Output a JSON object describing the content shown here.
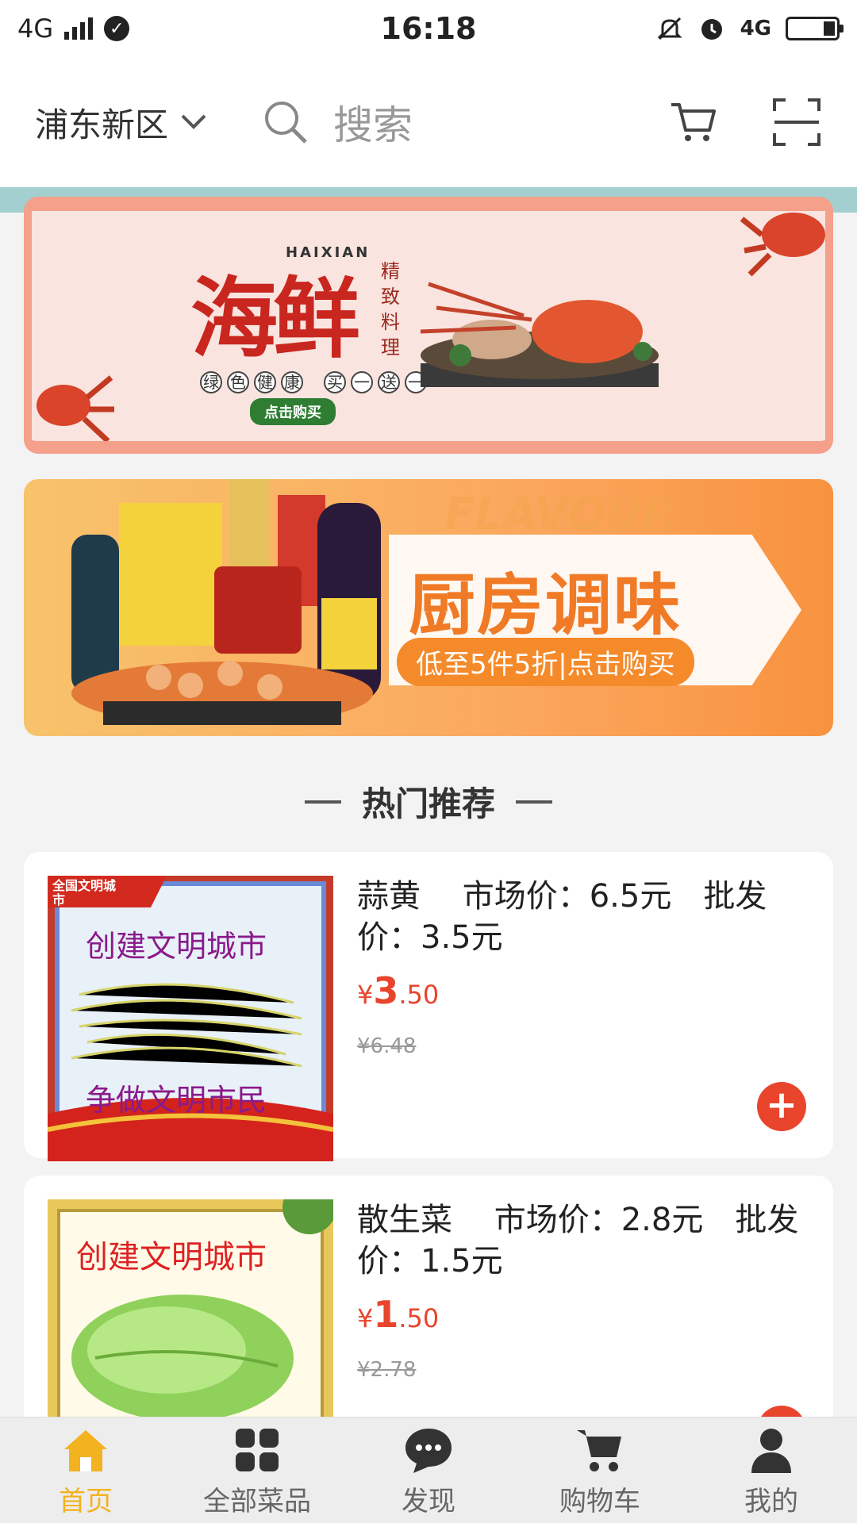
{
  "status_bar": {
    "network": "4G",
    "time": "16:18",
    "network_right": "4G"
  },
  "header": {
    "district": "浦东新区",
    "search_placeholder": "搜索"
  },
  "banners": {
    "seafood": {
      "title": "海鲜",
      "english": "HAIXIAN",
      "side_text": "精致料理",
      "tags": [
        "绿",
        "色",
        "健",
        "康",
        "买",
        "一",
        "送",
        "一"
      ],
      "button": "点击购买"
    },
    "kitchen": {
      "watermark": "FLAVOUR",
      "title": "厨房调味",
      "subtitle": "低至5件5折|点击购买"
    }
  },
  "section_title": "热门推荐",
  "products": [
    {
      "name": "蒜黄　 市场价：6.5元　批发价：3.5元",
      "currency": "¥",
      "price_int": "3",
      "price_dec": ".50",
      "old_price": "¥6.48",
      "image_banner_top": "创建文明城市",
      "image_banner_bottom": "争做文明市民",
      "image_corner": "全国文明城市"
    },
    {
      "name": "散生菜　 市场价：2.8元　批发价：1.5元",
      "currency": "¥",
      "price_int": "1",
      "price_dec": ".50",
      "old_price": "¥2.78",
      "image_banner_top": "创建文明城市"
    }
  ],
  "tabs": [
    {
      "label": "首页",
      "icon": "home-icon",
      "active": true
    },
    {
      "label": "全部菜品",
      "icon": "grid-icon",
      "active": false
    },
    {
      "label": "发现",
      "icon": "chat-icon",
      "active": false
    },
    {
      "label": "购物车",
      "icon": "cart-icon",
      "active": false
    },
    {
      "label": "我的",
      "icon": "user-icon",
      "active": false
    }
  ],
  "colors": {
    "accent_red": "#e8452c",
    "active_tab": "#f3b21f",
    "teal_strip": "#a3cfd0"
  }
}
